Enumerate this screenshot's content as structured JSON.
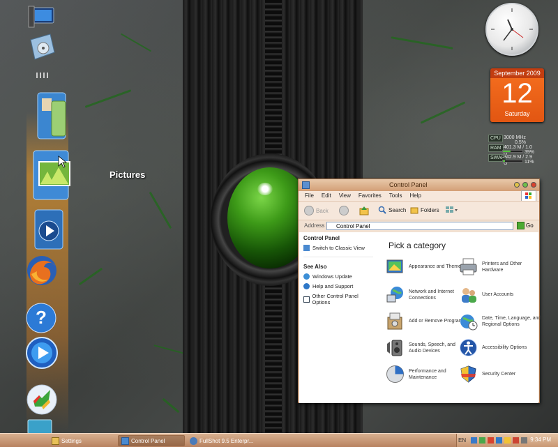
{
  "desktop": {
    "dock_label": "Pictures"
  },
  "calendar": {
    "month_year": "September 2009",
    "day": "12",
    "weekday": "Saturday"
  },
  "system_meter": {
    "cpu": {
      "label": "CPU",
      "speed": "3000 MHz",
      "usage": "0.5%"
    },
    "ram": {
      "label": "RAM",
      "value": "401.3 M / 1.0 G",
      "percent": "39%",
      "fill": 0.39
    },
    "swap": {
      "label": "SWAP",
      "value": "342.9 M / 2.9 G",
      "percent": "11%",
      "fill": 0.11
    }
  },
  "window": {
    "title": "Control Panel",
    "menu": [
      "File",
      "Edit",
      "View",
      "Favorites",
      "Tools",
      "Help"
    ],
    "toolbar": {
      "back": "Back",
      "search": "Search",
      "folders": "Folders"
    },
    "address": {
      "label": "Address",
      "value": "Control Panel",
      "go": "Go"
    },
    "side": {
      "panel_title": "Control Panel",
      "switch": "Switch to Classic View",
      "see_also_title": "See Also",
      "links": [
        "Windows Update",
        "Help and Support",
        "Other Control Panel Options"
      ]
    },
    "heading": "Pick a category",
    "categories": [
      {
        "label": "Appearance and Themes"
      },
      {
        "label": "Printers and Other Hardware"
      },
      {
        "label": "Network and Internet Connections"
      },
      {
        "label": "User Accounts"
      },
      {
        "label": "Add or Remove Programs"
      },
      {
        "label": "Date, Time, Language, and Regional Options"
      },
      {
        "label": "Sounds, Speech, and Audio Devices"
      },
      {
        "label": "Accessibility Options"
      },
      {
        "label": "Performance and Maintenance"
      },
      {
        "label": "Security Center"
      }
    ]
  },
  "taskbar": {
    "tasks": [
      "Settings",
      "Control Panel",
      "FullShot 9.5 Enterpr..."
    ],
    "lang": "EN",
    "time": "9:34 PM"
  },
  "colors": {
    "accent": "#f26b1d",
    "taskbar": "#c89570",
    "window_title": "#d39f76",
    "orb_green": "#3d9a18"
  }
}
